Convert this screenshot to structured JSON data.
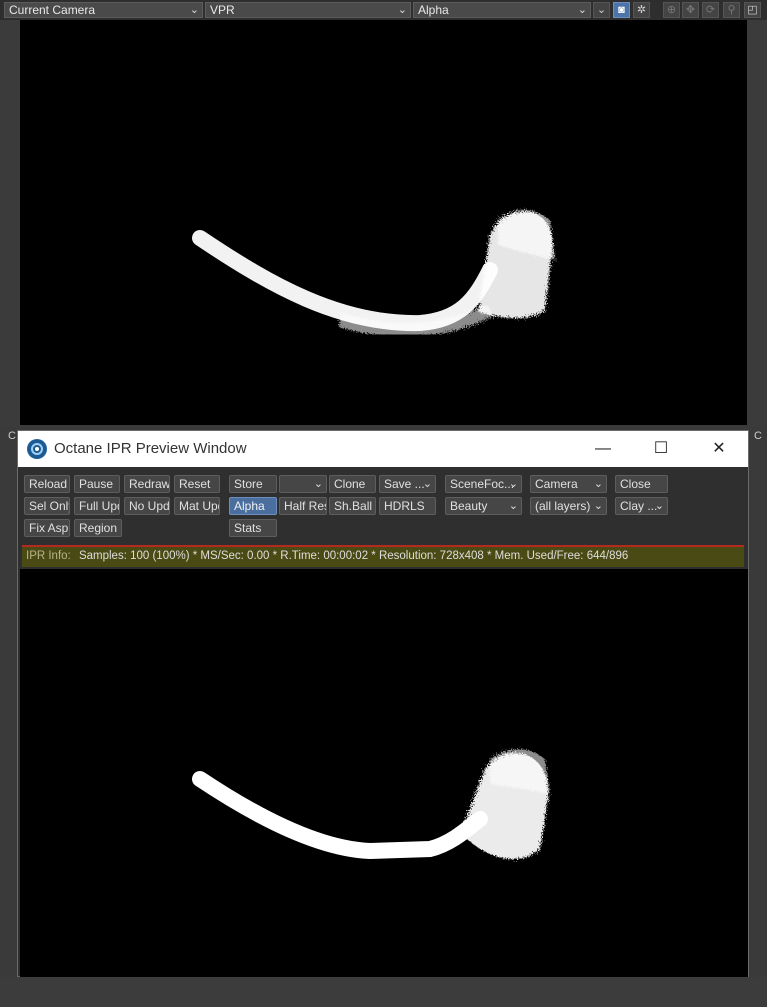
{
  "viewport": {
    "camera_select": "Current Camera",
    "mode_select": "VPR",
    "channel_select": "Alpha",
    "icons": [
      "chevron-down-icon",
      "camera-icon",
      "gear-icon",
      "move-icon",
      "pan-icon",
      "rotate-icon",
      "zoom-icon",
      "maximize-icon"
    ]
  },
  "window": {
    "title": "Octane IPR Preview Window",
    "min_symbol": "—",
    "max_symbol": "☐",
    "close_symbol": "✕"
  },
  "toolbar": {
    "row1": {
      "reload": "Reload",
      "pause": "Pause",
      "redraw": "Redraw",
      "reset": "Reset",
      "store": "Store",
      "clone": "Clone",
      "save": "Save ...",
      "scene_focus": "SceneFoc...",
      "camera": "Camera",
      "close": "Close"
    },
    "row2": {
      "sel_only": "Sel Only",
      "full_upd": "Full Upd.",
      "no_upd": "No Upd.",
      "mat_upd": "Mat Upd",
      "alpha": "Alpha",
      "half_res": "Half Res",
      "sh_ball": "Sh.Ball",
      "hdrls": "HDRLS",
      "beauty": "Beauty",
      "layers": "(all layers)",
      "clay": "Clay ..."
    },
    "row3": {
      "fix_asp": "Fix Asp.",
      "region": "Region",
      "stats": "Stats"
    }
  },
  "info": {
    "label": "IPR Info:",
    "text": "Samples: 100 (100%)  *  MS/Sec: 0.00  *  R.Time: 00:00:02  *  Resolution: 728x408  *  Mem. Used/Free: 644/896"
  },
  "background_labels": {
    "left": "C",
    "right": "C"
  },
  "colors": {
    "accent": "#4a6f9e",
    "info_bar": "#4a4a14",
    "info_border": "#b52a1f"
  }
}
